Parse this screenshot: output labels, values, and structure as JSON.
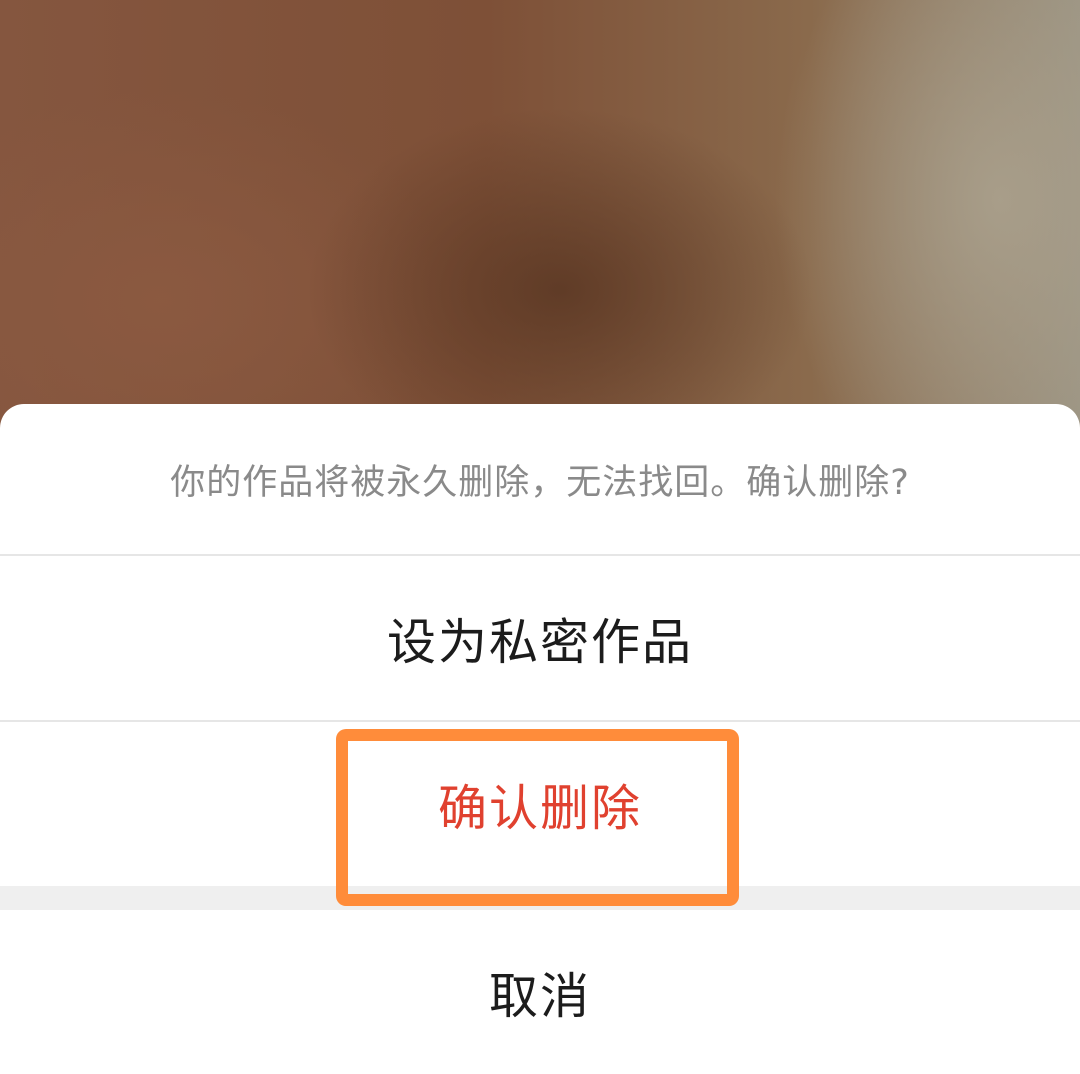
{
  "dialog": {
    "prompt": "你的作品将被永久删除，无法找回。确认删除?",
    "options": [
      {
        "label": "设为私密作品",
        "style": "normal"
      },
      {
        "label": "确认删除",
        "style": "danger"
      }
    ],
    "cancel_label": "取消"
  },
  "colors": {
    "danger": "#e0412f",
    "highlight": "#ff8c3a",
    "prompt_text": "#8a8a8a"
  }
}
